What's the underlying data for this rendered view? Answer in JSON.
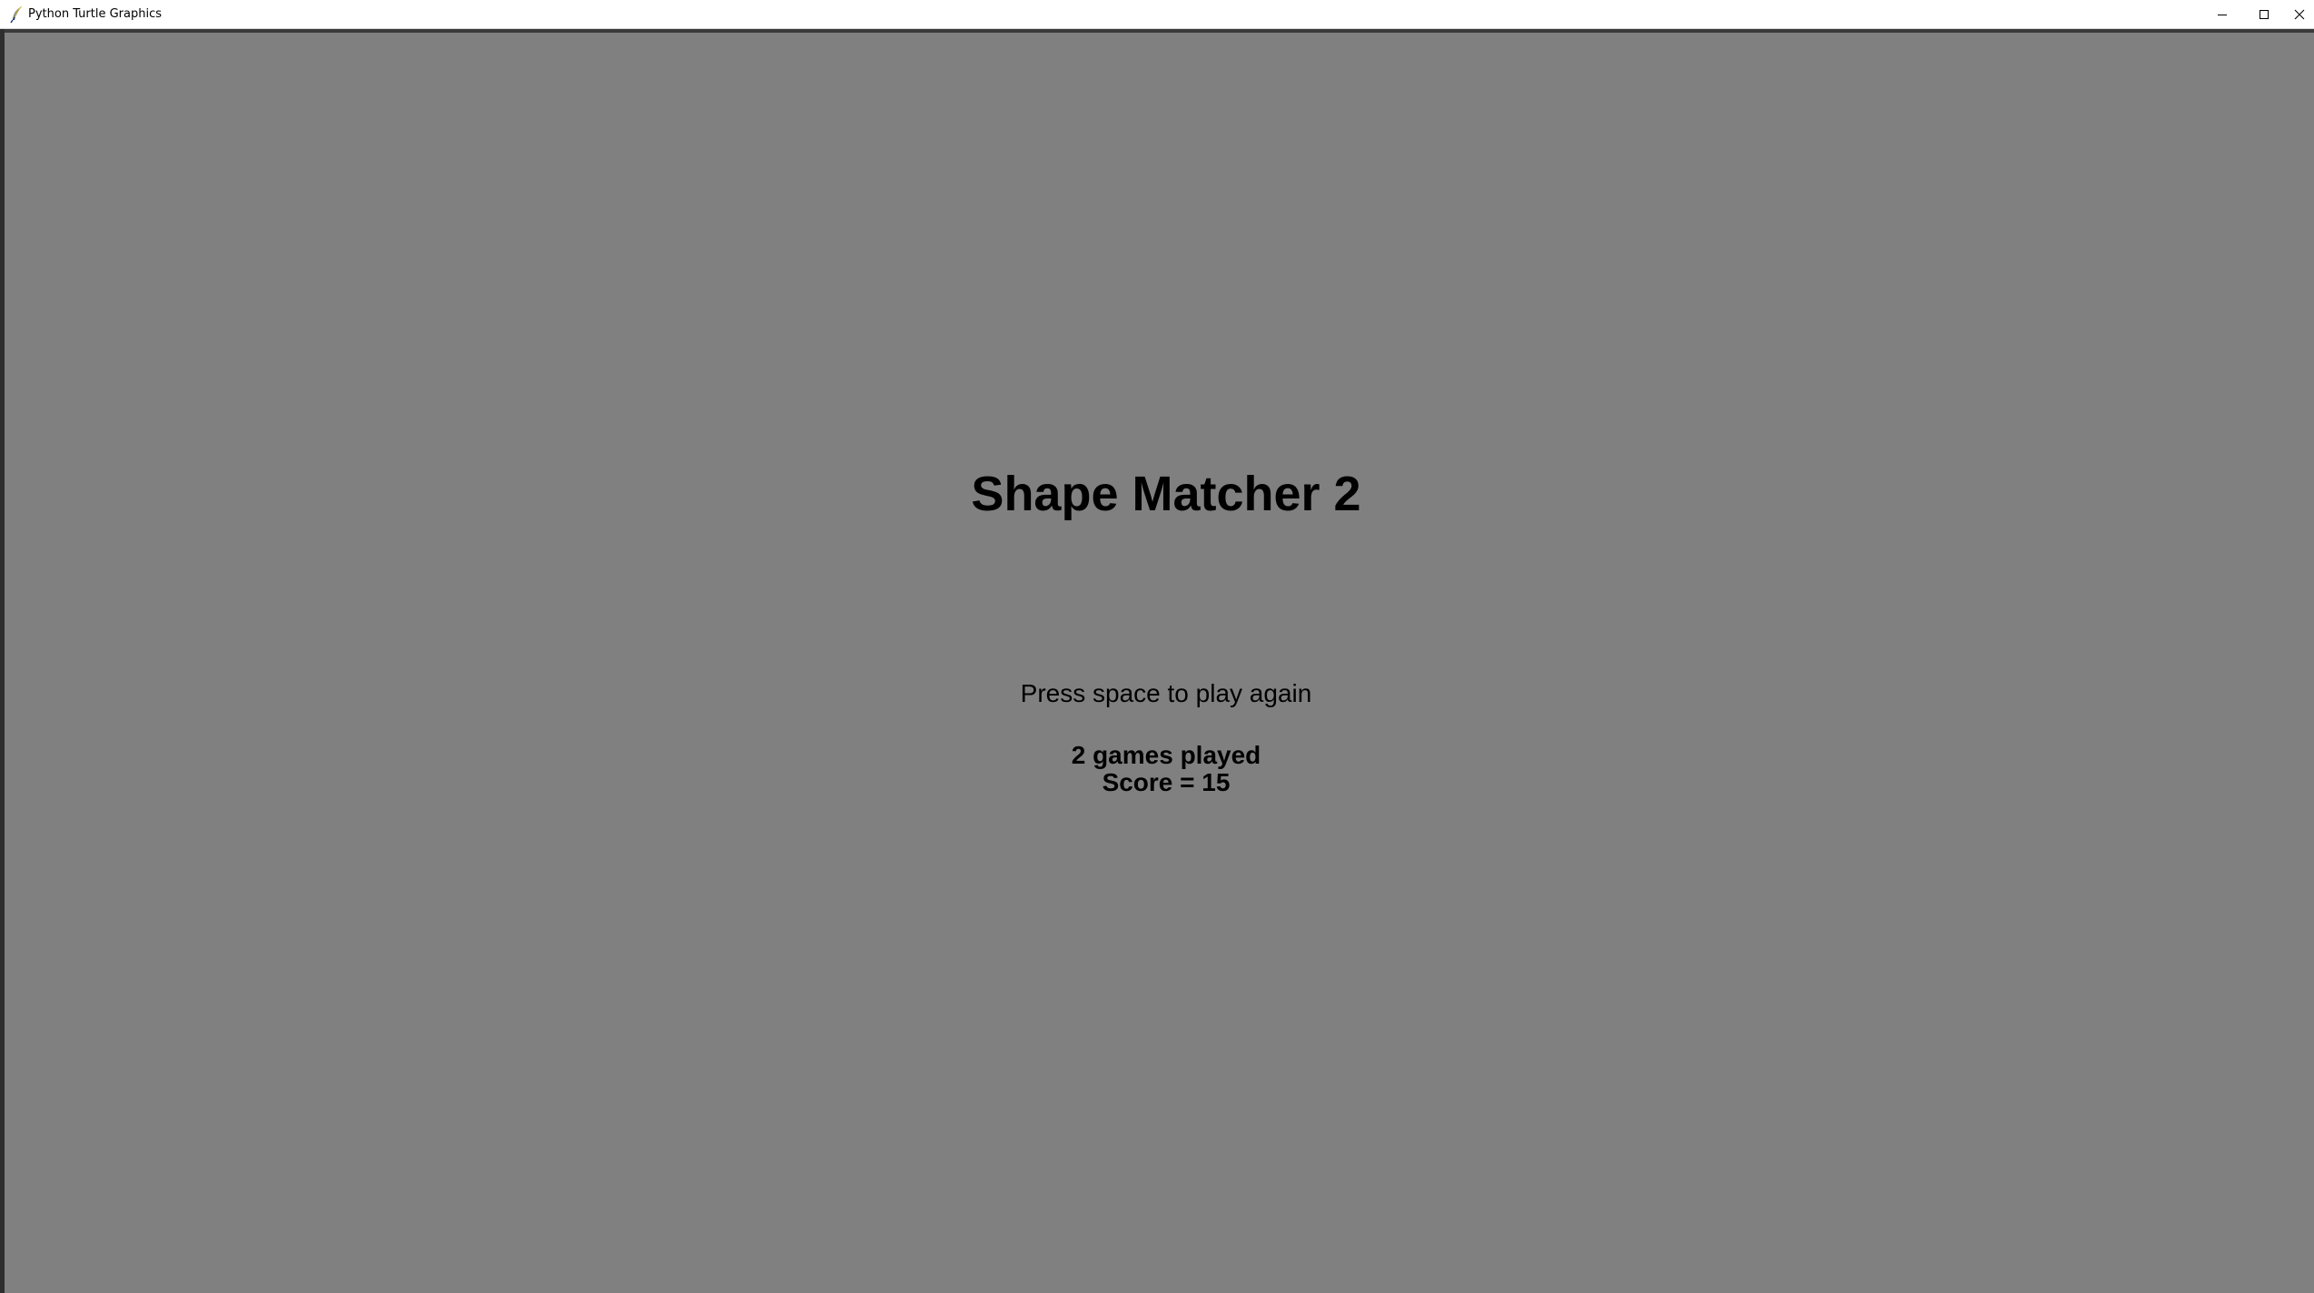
{
  "window": {
    "title": "Python Turtle Graphics",
    "icon": "feather-icon",
    "controls": {
      "minimize_icon": "minimize-icon",
      "maximize_icon": "maximize-icon",
      "close_icon": "close-icon"
    }
  },
  "canvas": {
    "background_color": "#808080",
    "text_color": "#000000",
    "title": "Shape Matcher 2",
    "prompt": "Press space to play again",
    "games_played": "2 games played",
    "score": "Score = 15"
  }
}
